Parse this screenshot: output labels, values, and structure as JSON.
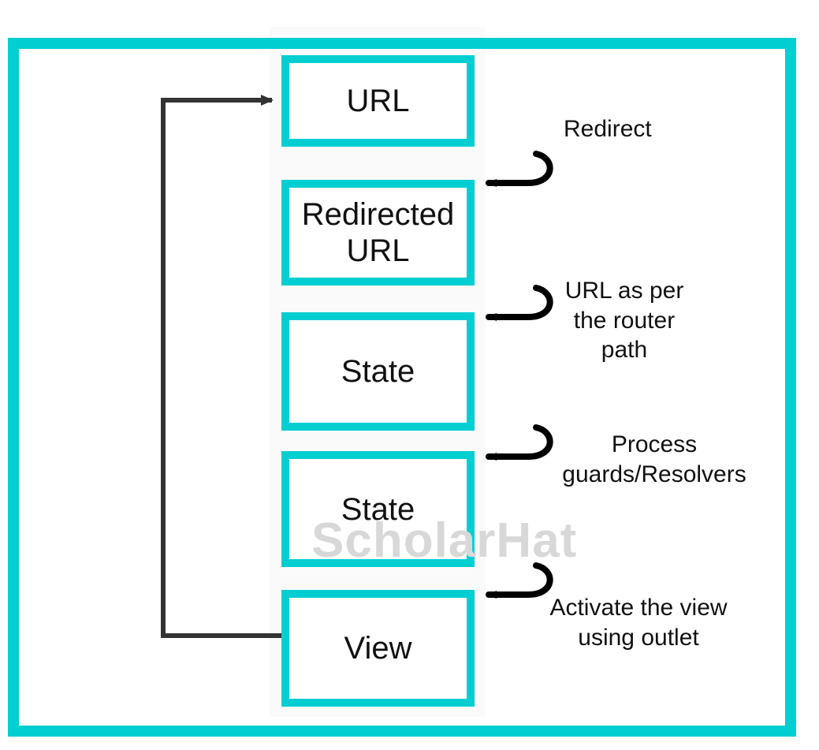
{
  "nodes": {
    "url": {
      "label": "URL"
    },
    "redirected": {
      "label": "Redirected\nURL"
    },
    "state1": {
      "label": "State"
    },
    "state2": {
      "label": "State"
    },
    "view": {
      "label": "View"
    }
  },
  "annotations": {
    "redirect": {
      "text": "Redirect"
    },
    "urlRouter": {
      "text": "URL as per\nthe router\npath"
    },
    "guards": {
      "text": "Process\nguards/Resolvers"
    },
    "activate": {
      "text": "Activate the view\nusing outlet"
    }
  },
  "watermark": "ScholarHat",
  "colors": {
    "accent": "#00CED1",
    "arrow": "#000000",
    "feedback": "#333333"
  }
}
